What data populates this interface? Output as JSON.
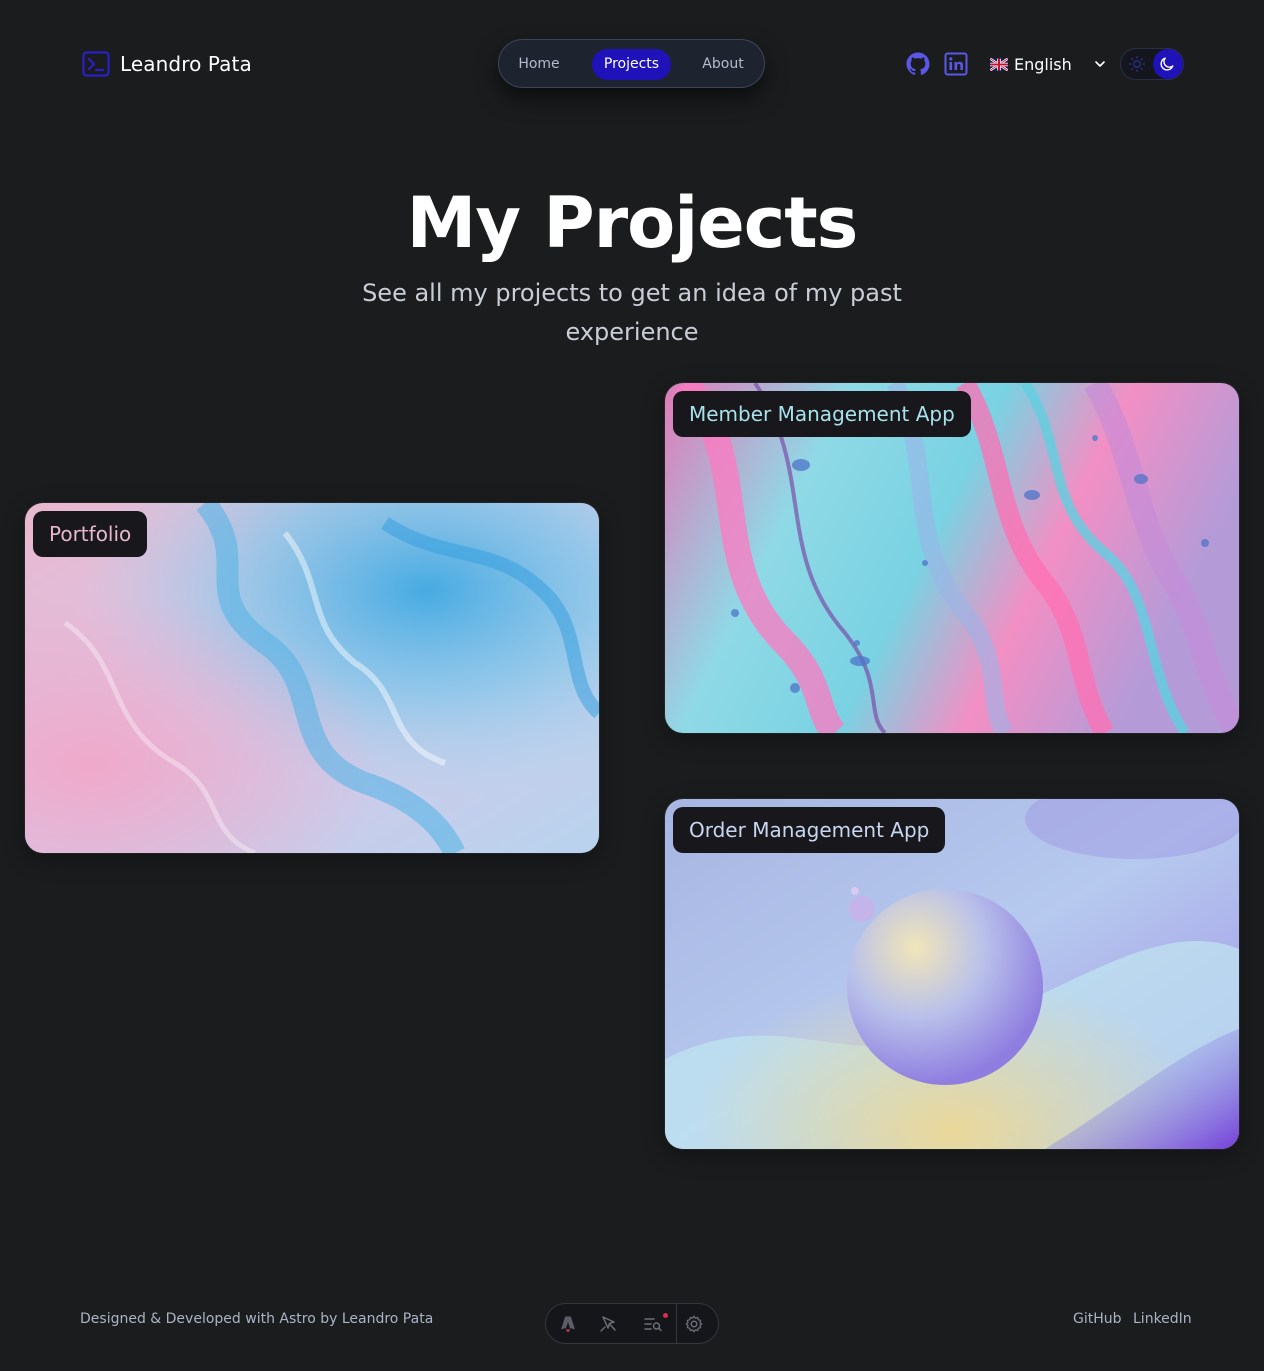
{
  "header": {
    "brand_name": "Leandro Pata",
    "nav": {
      "home": "Home",
      "projects": "Projects",
      "about": "About",
      "active": "Projects"
    },
    "social": [
      "github-icon",
      "linkedin-icon"
    ],
    "language": {
      "selected": "English",
      "flag": "uk-flag-icon"
    },
    "theme": {
      "mode": "dark",
      "accent": "#1e12b8"
    }
  },
  "hero": {
    "title": "My Projects",
    "subtitle": "See all my projects to get an idea of my past experience"
  },
  "projects": [
    {
      "title": "Portfolio"
    },
    {
      "title": "Member Management App"
    },
    {
      "title": "Order Management App"
    }
  ],
  "footer": {
    "credit": "Designed & Developed with Astro by Leandro Pata",
    "links": [
      "GitHub",
      "LinkedIn"
    ]
  },
  "colors": {
    "background": "#1b1c1e",
    "accent": "#1e12b8",
    "nav_pill_bg": "#1e2330",
    "icon_blue": "#5b57e8"
  }
}
